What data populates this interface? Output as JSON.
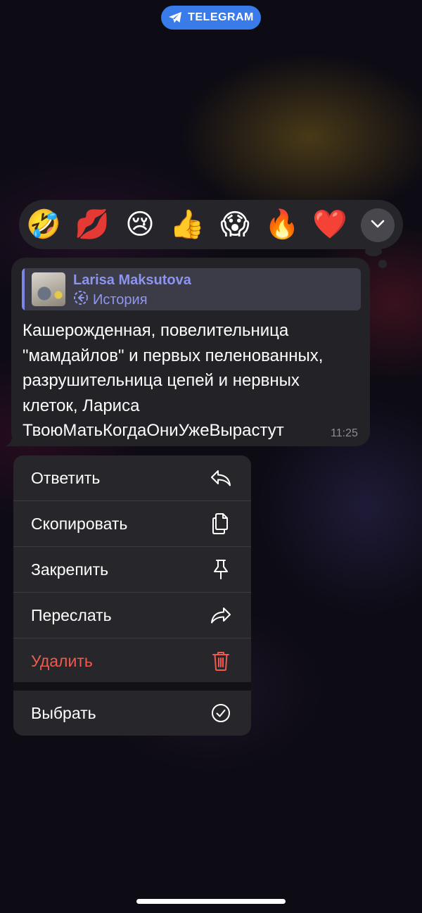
{
  "badge": {
    "label": "TELEGRAM"
  },
  "reactions": [
    {
      "emoji": "🤣",
      "name": "rolling-laughing-reaction"
    },
    {
      "emoji": "💋",
      "name": "kiss-reaction"
    },
    {
      "emoji": "😢",
      "name": "crying-reaction"
    },
    {
      "emoji": "👍",
      "name": "thumbs-up-reaction"
    },
    {
      "emoji": "😱",
      "name": "screaming-reaction"
    },
    {
      "emoji": "🔥",
      "name": "fire-reaction"
    },
    {
      "emoji": "❤️",
      "name": "heart-reaction"
    }
  ],
  "message": {
    "reply": {
      "author": "Larisa Maksutova",
      "type": "История"
    },
    "lines": [
      "Кашерожденная, повелительница",
      "\"мамдайлов\" и первых пеленованных,",
      "разрушительница цепей и нервных",
      "клеток, Лариса",
      "ТвоюМатьКогдаОниУжеВырастут"
    ],
    "time": "11:25"
  },
  "menu": {
    "reply": "Ответить",
    "copy": "Скопировать",
    "pin": "Закрепить",
    "forward": "Переслать",
    "delete": "Удалить",
    "select": "Выбрать"
  },
  "colors": {
    "accent": "#3a7bea",
    "reply_name": "#8d94f0",
    "destructive": "#ee5a4d",
    "bubble": "#232226",
    "menu": "#27272b"
  }
}
